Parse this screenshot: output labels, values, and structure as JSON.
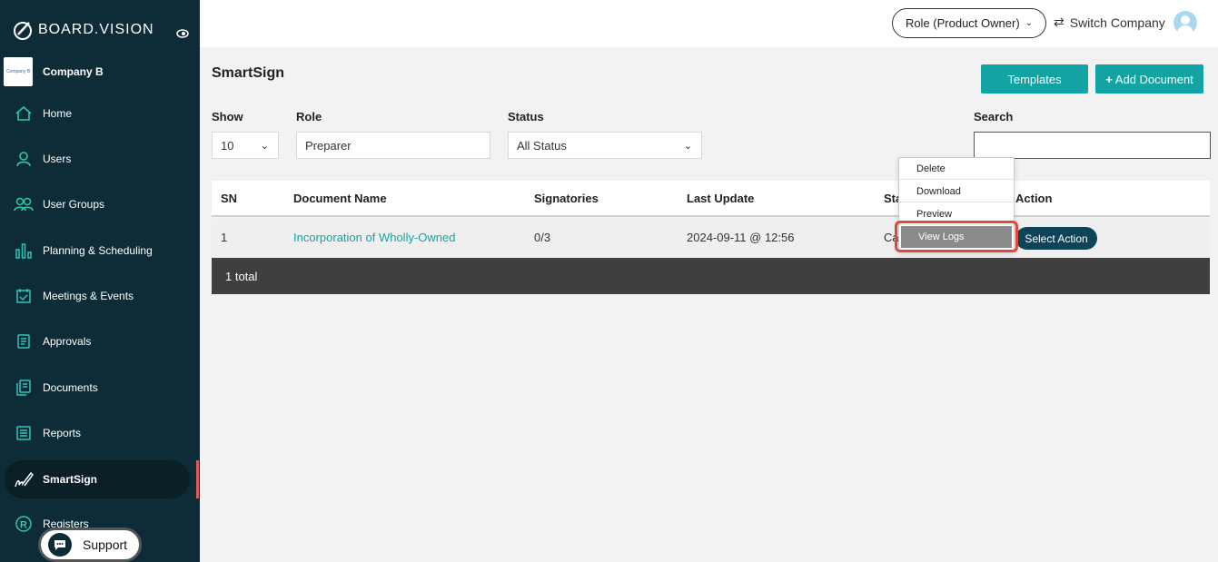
{
  "sidebar": {
    "brand": "BOARD.VISION",
    "company_logo_text": "Company B",
    "company_name": "Company B",
    "items": [
      {
        "label": "Home",
        "icon": "home-icon"
      },
      {
        "label": "Users",
        "icon": "user-icon"
      },
      {
        "label": "User Groups",
        "icon": "users-icon"
      },
      {
        "label": "Planning & Scheduling",
        "icon": "bar-chart-icon"
      },
      {
        "label": "Meetings & Events",
        "icon": "calendar-check-icon"
      },
      {
        "label": "Approvals",
        "icon": "approvals-icon"
      },
      {
        "label": "Documents",
        "icon": "documents-icon"
      },
      {
        "label": "Reports",
        "icon": "reports-icon"
      },
      {
        "label": "SmartSign",
        "icon": "signature-icon",
        "active": true
      },
      {
        "label": "Registers",
        "icon": "registered-icon"
      }
    ],
    "support_label": "Support"
  },
  "header": {
    "role": "Role (Product Owner)",
    "switch_company": "Switch Company"
  },
  "main": {
    "title": "SmartSign",
    "templates_label": "Templates",
    "add_document_label": "Add Document",
    "filters": {
      "show_label": "Show",
      "show_value": "10",
      "role_label": "Role",
      "role_value": "Preparer",
      "status_label": "Status",
      "status_value": "All Status",
      "search_label": "Search",
      "search_value": ""
    },
    "table": {
      "headers": [
        "SN",
        "Document Name",
        "Signatories",
        "Last Update",
        "Sta",
        "Action"
      ],
      "rows": [
        {
          "sn": "1",
          "document_name": "Incorporation of Wholly-Owned",
          "signatories": "0/3",
          "last_update": "2024-09-11 @ 12:56",
          "status": "Ca",
          "action": "Select Action"
        }
      ],
      "total": "1 total"
    },
    "action_menu": [
      "Delete",
      "Download",
      "Preview",
      "View Logs"
    ]
  },
  "colors": {
    "sidebar_bg": "#0e2c38",
    "accent_teal": "#13a3a3",
    "highlight_red": "#e0483a"
  }
}
